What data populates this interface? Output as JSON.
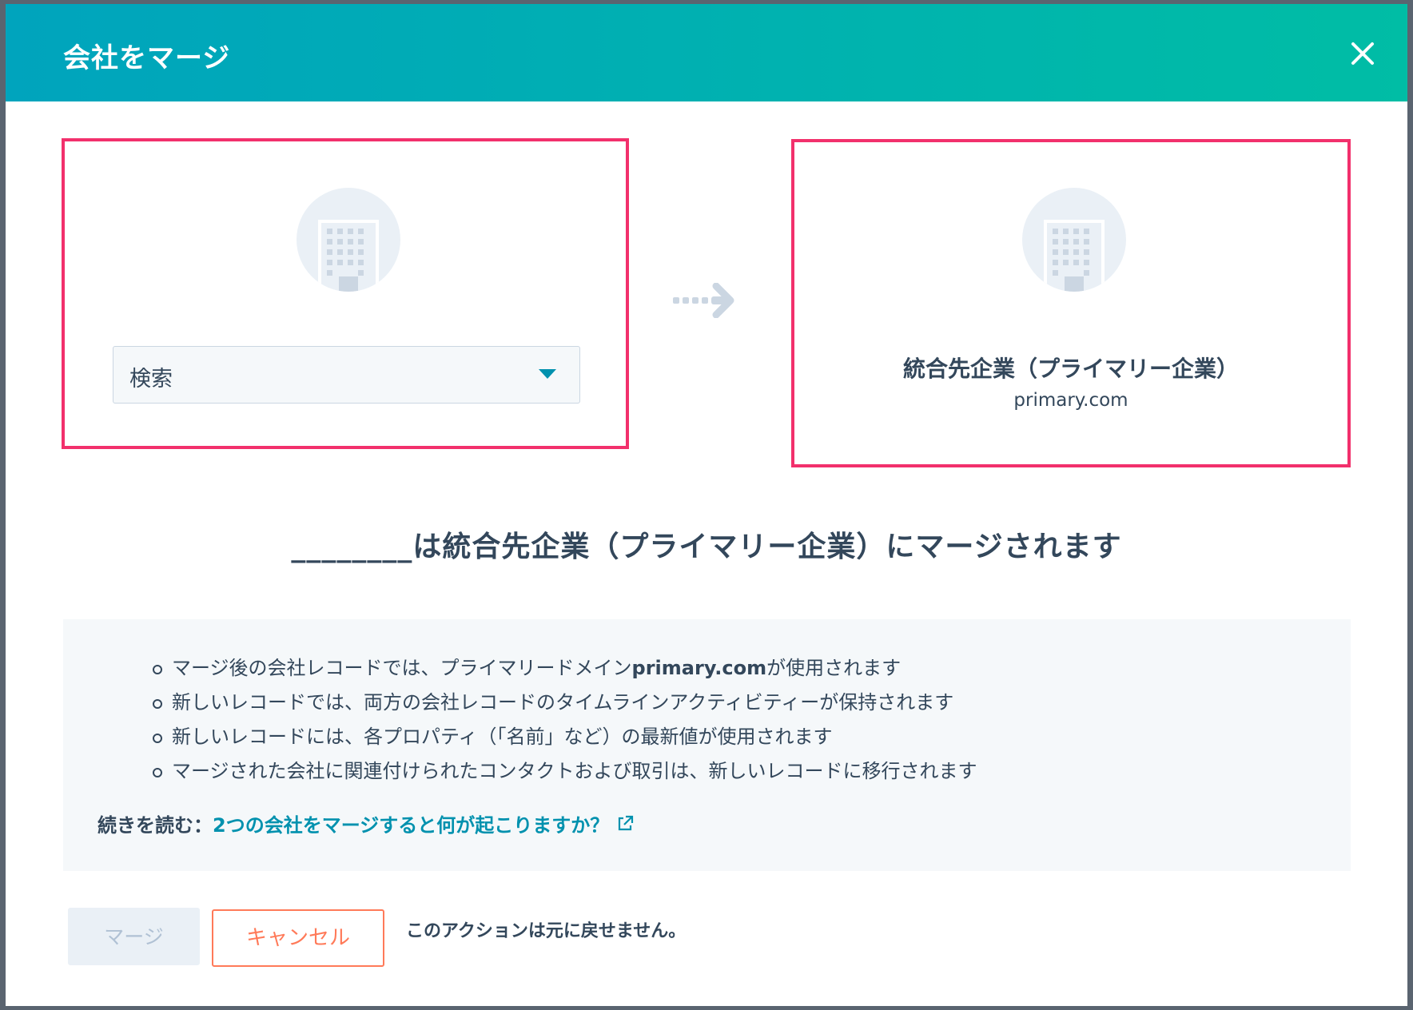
{
  "modal": {
    "title": "会社をマージ",
    "close_icon": "close-icon"
  },
  "left_company": {
    "icon": "building-icon",
    "search_placeholder": "検索",
    "dropdown_icon": "caret-down-icon"
  },
  "arrow_icon": "dotted-arrow-right-icon",
  "right_company": {
    "icon": "building-icon",
    "name": "統合先企業（プライマリー企業）",
    "domain": "primary.com"
  },
  "merge_sentence": "________は統合先企業（プライマリー企業）にマージされます",
  "info": {
    "bullets": [
      {
        "pre": "マージ後の会社レコードでは、プライマリードメイン",
        "bold": "primary.com",
        "post": "が使用されます"
      },
      {
        "pre": "新しいレコードでは、両方の会社レコードのタイムラインアクティビティーが保持されます",
        "bold": "",
        "post": ""
      },
      {
        "pre": "新しいレコードには、各プロパティ（「名前」など）の最新値が使用されます",
        "bold": "",
        "post": ""
      },
      {
        "pre": "マージされた会社に関連付けられたコンタクトおよび取引は、新しいレコードに移行されます",
        "bold": "",
        "post": ""
      }
    ],
    "read_more_label": "続きを読む：",
    "read_more_link": "2つの会社をマージすると何が起こりますか？",
    "external_icon": "external-link-icon"
  },
  "footer": {
    "merge_label": "マージ",
    "cancel_label": "キャンセル",
    "warning": "このアクションは元に戻せません。"
  },
  "colors": {
    "header_start": "#00a4bd",
    "header_end": "#00bda5",
    "highlight_border": "#f2306c",
    "link": "#0091ae",
    "cancel": "#ff7a59",
    "text": "#33475b"
  }
}
